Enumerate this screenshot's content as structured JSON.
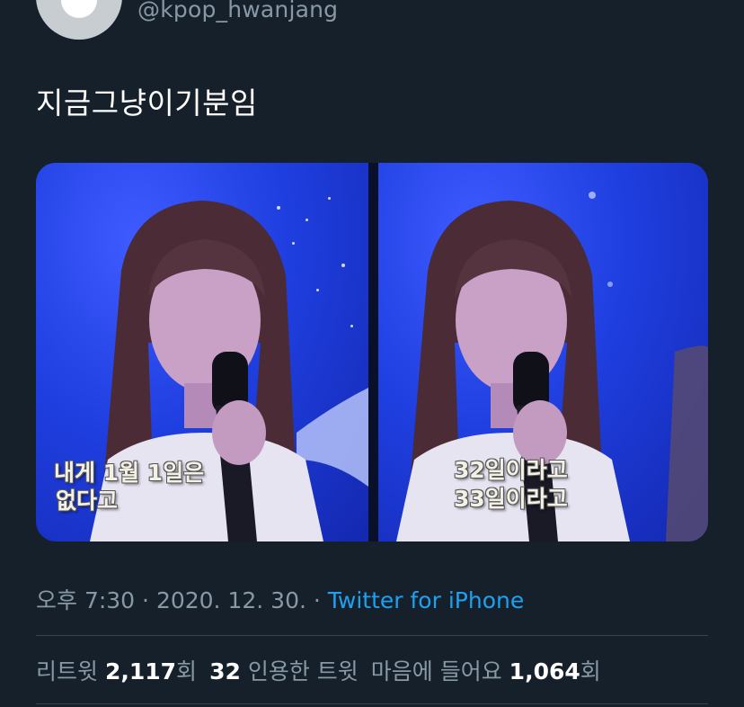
{
  "author": {
    "handle": "@kpop_hwanjang",
    "avatar_icon": "default-profile-avatar-icon"
  },
  "tweet": {
    "text": "지금그냥이기분임"
  },
  "media": {
    "left_image": {
      "subtitle_line1": "내게 1월 1일은",
      "subtitle_line2": "없다고"
    },
    "right_image": {
      "subtitle_line1": "32일이라고",
      "subtitle_line2": "33일이라고"
    }
  },
  "meta": {
    "time": "오후 7:30",
    "separator1": " · ",
    "date": "2020. 12. 30.",
    "separator2": " · ",
    "source": "Twitter for iPhone"
  },
  "stats": {
    "retweets_label": "리트윗",
    "retweets_count": "2,117",
    "retweets_suffix": "회",
    "quotes_count": "32",
    "quotes_label": "인용한 트윗",
    "likes_label": "마음에 들어요",
    "likes_count": "1,064",
    "likes_suffix": "회"
  },
  "colors": {
    "background": "#15202b",
    "secondary_text": "#8899a6",
    "link": "#1da1f2",
    "divider": "#38444d"
  }
}
